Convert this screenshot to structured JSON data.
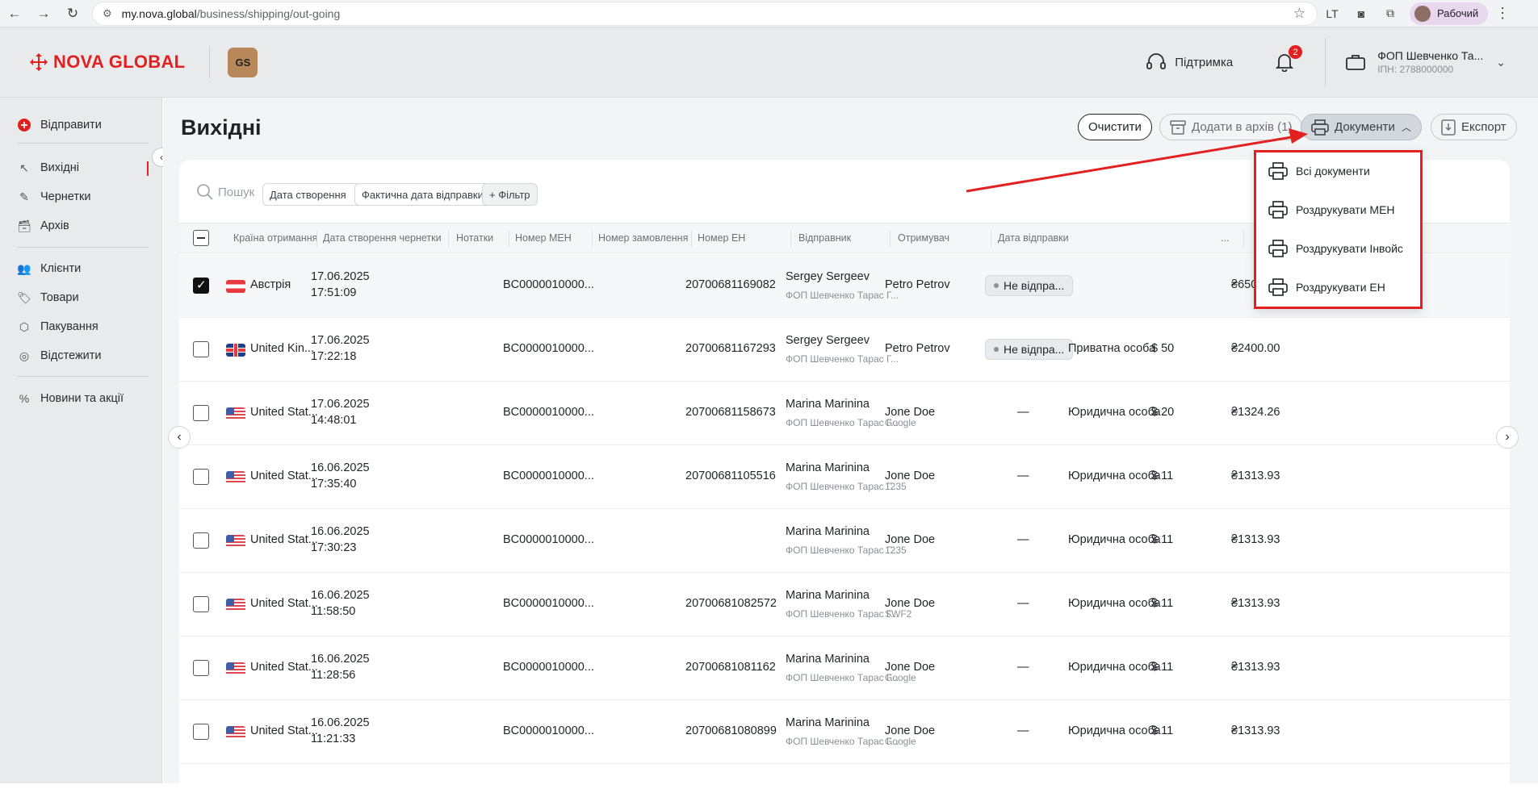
{
  "browser": {
    "url_host": "my.nova.global",
    "url_path": "/business/shipping/out-going",
    "profile_label": "Рабочий"
  },
  "header": {
    "logo_text": "NOVA GLOBAL",
    "gs_badge": "GS",
    "support_label": "Підтримка",
    "notifications_count": "2",
    "account_name": "ФОП Шевченко Та...",
    "account_tax": "ІПН: 2788000000"
  },
  "sidebar": {
    "send": "Відправити",
    "outgoing": "Вихідні",
    "drafts": "Чернетки",
    "archive": "Архів",
    "clients": "Клієнти",
    "goods": "Товари",
    "packaging": "Пакування",
    "tracking": "Відстежити",
    "news": "Новини та акції"
  },
  "page": {
    "title": "Вихідні",
    "clear_label": "Очистити",
    "archive_label": "Додати в архів (1)",
    "documents_label": "Документи",
    "export_label": "Експорт"
  },
  "filters": {
    "search_placeholder": "Пошук",
    "created_date": "Дата створення",
    "actual_send_date": "Фактична дата відправки",
    "add_filter": "+ Фільтр"
  },
  "table": {
    "headers": [
      "Країна отримання",
      "Дата створення чернетки",
      "Нотатки",
      "Номер MEH",
      "Номер замовлення",
      "Номер ЕН",
      "Відправник",
      "Отримувач",
      "Дата відправки",
      "..."
    ],
    "rows": [
      {
        "country": "Австрія",
        "flag": "at",
        "date": "17.06.2025",
        "time": "17:51:09",
        "meh": "BC0000010000...",
        "en": "20700681169082",
        "sender": "Sergey Sergeev",
        "sender_sub": "ФОП Шевченко Тарас Г...",
        "recipient": "Petro Petrov",
        "recipient_sub": "",
        "status": "Не відпра...",
        "type": "",
        "amount": "",
        "total": "₴650.00",
        "checked": true
      },
      {
        "country": "United Kin...",
        "flag": "uk",
        "date": "17.06.2025",
        "time": "17:22:18",
        "meh": "BC0000010000...",
        "en": "20700681167293",
        "sender": "Sergey Sergeev",
        "sender_sub": "ФОП Шевченко Тарас Г...",
        "recipient": "Petro Petrov",
        "recipient_sub": "",
        "status": "Не відпра...",
        "type": "Приватна особа",
        "amount": "$ 50",
        "total": "₴2400.00",
        "checked": false
      },
      {
        "country": "United Stat...",
        "flag": "us",
        "date": "17.06.2025",
        "time": "14:48:01",
        "meh": "BC0000010000...",
        "en": "20700681158673",
        "sender": "Marina Marinina",
        "sender_sub": "ФОП Шевченко Тарас Г...",
        "recipient": "Jone Doe",
        "recipient_sub": "Google",
        "status": "—",
        "type": "Юридична особа",
        "amount": "$ 20",
        "total": "₴1324.26",
        "checked": false
      },
      {
        "country": "United Stat...",
        "flag": "us",
        "date": "16.06.2025",
        "time": "17:35:40",
        "meh": "BC0000010000...",
        "en": "20700681105516",
        "sender": "Marina Marinina",
        "sender_sub": "ФОП Шевченко Тарас Г...",
        "recipient": "Jone Doe",
        "recipient_sub": "1235",
        "status": "—",
        "type": "Юридична особа",
        "amount": "$ 11",
        "total": "₴1313.93",
        "checked": false
      },
      {
        "country": "United Stat...",
        "flag": "us",
        "date": "16.06.2025",
        "time": "17:30:23",
        "meh": "BC0000010000...",
        "en": "",
        "sender": "Marina Marinina",
        "sender_sub": "ФОП Шевченко Тарас Г...",
        "recipient": "Jone Doe",
        "recipient_sub": "1235",
        "status": "—",
        "type": "Юридична особа",
        "amount": "$ 11",
        "total": "₴1313.93",
        "checked": false
      },
      {
        "country": "United Stat...",
        "flag": "us",
        "date": "16.06.2025",
        "time": "11:58:50",
        "meh": "BC0000010000...",
        "en": "20700681082572",
        "sender": "Marina Marinina",
        "sender_sub": "ФОП Шевченко Тарас Г...",
        "recipient": "Jone Doe",
        "recipient_sub": "SWF2",
        "status": "—",
        "type": "Юридична особа",
        "amount": "$ 11",
        "total": "₴1313.93",
        "checked": false
      },
      {
        "country": "United Stat...",
        "flag": "us",
        "date": "16.06.2025",
        "time": "11:28:56",
        "meh": "BC0000010000...",
        "en": "20700681081162",
        "sender": "Marina Marinina",
        "sender_sub": "ФОП Шевченко Тарас Г...",
        "recipient": "Jone Doe",
        "recipient_sub": "Google",
        "status": "—",
        "type": "Юридична особа",
        "amount": "$ 11",
        "total": "₴1313.93",
        "checked": false
      },
      {
        "country": "United Stat...",
        "flag": "us",
        "date": "16.06.2025",
        "time": "11:21:33",
        "meh": "BC0000010000...",
        "en": "20700681080899",
        "sender": "Marina Marinina",
        "sender_sub": "ФОП Шевченко Тарас Г...",
        "recipient": "Jone Doe",
        "recipient_sub": "Google",
        "status": "—",
        "type": "Юридична особа",
        "amount": "$ 11",
        "total": "₴1313.93",
        "checked": false
      }
    ]
  },
  "dropdown": {
    "items": [
      "Всі документи",
      "Роздрукувати MEH",
      "Роздрукувати Інвойс",
      "Роздрукувати ЕН"
    ]
  },
  "colors": {
    "brand_red": "#e1201f",
    "annotation_red": "#e1201f"
  }
}
